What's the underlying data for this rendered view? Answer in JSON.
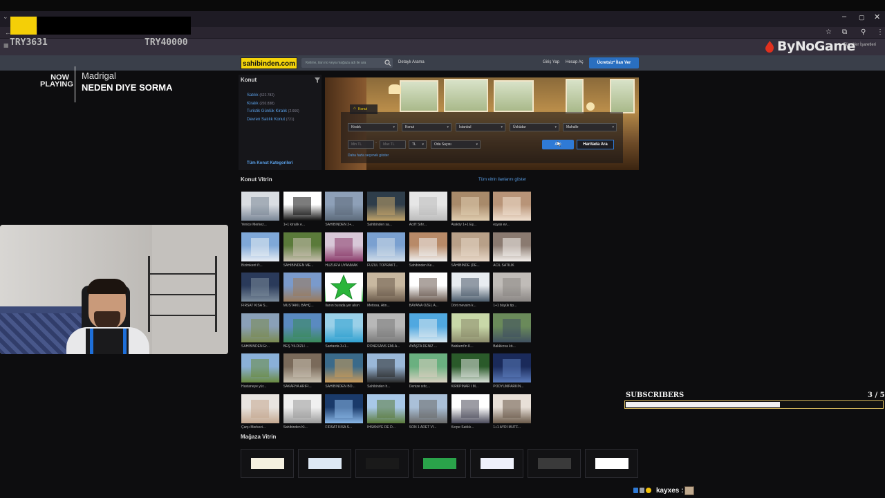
{
  "overlay": {
    "currency_left": "TRY3631",
    "currency_right": "TRY40000",
    "brand": "ByNoGame",
    "bookmarks_all": "Tüm Yer İşaretleri",
    "now_playing": "NOW PLAYING",
    "artist": "Madrigal",
    "song": "NEDEN DIYE SORMA",
    "subscribers_label": "SUBSCRIBERS",
    "subscribers_count": "3 / 5",
    "subscribers_progress": 0.6,
    "chat_user": "kayxes :"
  },
  "header": {
    "logo": "sahibinden.com",
    "search_placeholder": "Kelime, ilan no veya mağaza adı ile ara",
    "detailed_search": "Detaylı Arama",
    "login": "Giriş Yap",
    "register": "Hesap Aç",
    "post_ad": "Ücretsiz* İlan Ver"
  },
  "categories": {
    "title": "Konut",
    "items": [
      {
        "label": "Satılık",
        "count": "(622.782)"
      },
      {
        "label": "Kiralık",
        "count": "(202.838)"
      },
      {
        "label": "Turistik Günlük Kiralık",
        "count": "(2.666)"
      },
      {
        "label": "Devren Satılık Konut",
        "count": "(721)"
      }
    ],
    "all_link": "Tüm Konut Kategorileri"
  },
  "search_panel": {
    "tab": "Konut",
    "selects_row1": [
      "Kiralık",
      "Konut",
      "İstanbul",
      "Üsküdar",
      "Mahalle"
    ],
    "min_tl": "Min TL",
    "max_tl": "Max TL",
    "currency": "TL",
    "rooms": "Oda Sayısı",
    "search_button": "Ara",
    "map_button": "Haritada Ara",
    "more_options": "Daha fazla seçenek göster"
  },
  "vitrin": {
    "title": "Konut Vitrin",
    "all_link": "Tüm vitrin ilanlarını göster",
    "labels": [
      "Yenice Merkez...",
      "1+1 kiralık e...",
      "SAHİBİNDEN 2+...",
      "Sahibinden sa...",
      "Acil!! Sıfır...",
      "Ataköy 1+1 Eş...",
      "eşyalı ev...",
      "Bizimkent i't...",
      "SAHİBİNDEN ME...",
      "HUZUR'A UYANMAK",
      "FUZUL TOPRAKT...",
      "Sahibinden Ke...",
      "SAHİBİNDE (DE...",
      "ACİL SATILIK",
      "FIRSAT KISA S...",
      "MÜSTAKİL BAHÇ...",
      "İlanın burada yer alsın",
      "Metissa, Atin...",
      "BAYANA ÖZEL A...",
      "Dört mevsim k...",
      "1+1 büyük tip...",
      "SAHİBİNDEN Er...",
      "BEŞ YILDIZLI ...",
      "Santarda 3+1...",
      "RÖNESANS EMLA...",
      "AYAŞTA DENİZ ...",
      "Babkent'in K...",
      "Bakkkova kö...",
      "Hastaneye yür...",
      "SAKARYA ARİFİ...",
      "SAHİBİNDEN BO...",
      "Sahibinden h...",
      "Denize sıfır,...",
      "KIRKPINAR I M...",
      "PODYUMPARKIN...",
      "Çarşı Merkezi...",
      "Sahibinden Ki...",
      "FIRSAT KISA S...",
      "İHSANİYE DE D...",
      "SON 1 ADET Vİ...",
      "Kerpe Satılık...",
      "1+1 AYRI MUTF..."
    ]
  },
  "magaza": {
    "title": "Mağaza Vitrin",
    "logos": [
      "mimoza emlak",
      "globe",
      "emlak",
      "Mağazanız burada yer alsın",
      "ilan",
      "EK EMLAK",
      ""
    ]
  }
}
